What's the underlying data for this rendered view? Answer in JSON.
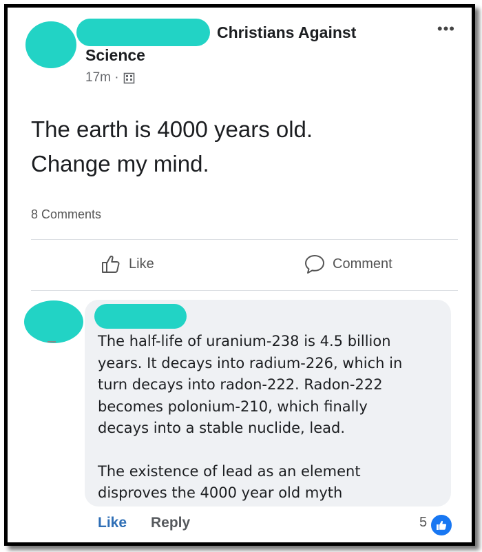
{
  "post": {
    "group_name_line1": "Christians Against",
    "group_name_line2": "Science",
    "more_icon": "•••",
    "time": "17m ·",
    "text_line1": "The earth is 4000 years old.",
    "text_line2": "Change my mind.",
    "comments_count": "8 Comments"
  },
  "actions": {
    "like": "Like",
    "comment": "Comment"
  },
  "comment": {
    "paragraph1_lines": [
      "The half-life of uranium-238 is 4.5 billion",
      "years. It decays into radium-226, which in",
      "turn decays into radon-222. Radon-222",
      "becomes polonium-210, which finally",
      "decays into a stable nuclide, lead."
    ],
    "paragraph2_lines": [
      "The existence of lead as an element",
      "disproves the 4000 year old myth"
    ],
    "like": "Like",
    "reply": "Reply",
    "reaction_count": "5"
  },
  "colors": {
    "redaction": "#22d3c5",
    "link_blue": "#2f6fb6",
    "reaction_blue": "#1877f2",
    "bubble_bg": "#eff1f4"
  },
  "icons": [
    "more-icon",
    "building-icon",
    "thumbs-up-icon",
    "comment-bubble-icon",
    "like-reaction-icon"
  ]
}
